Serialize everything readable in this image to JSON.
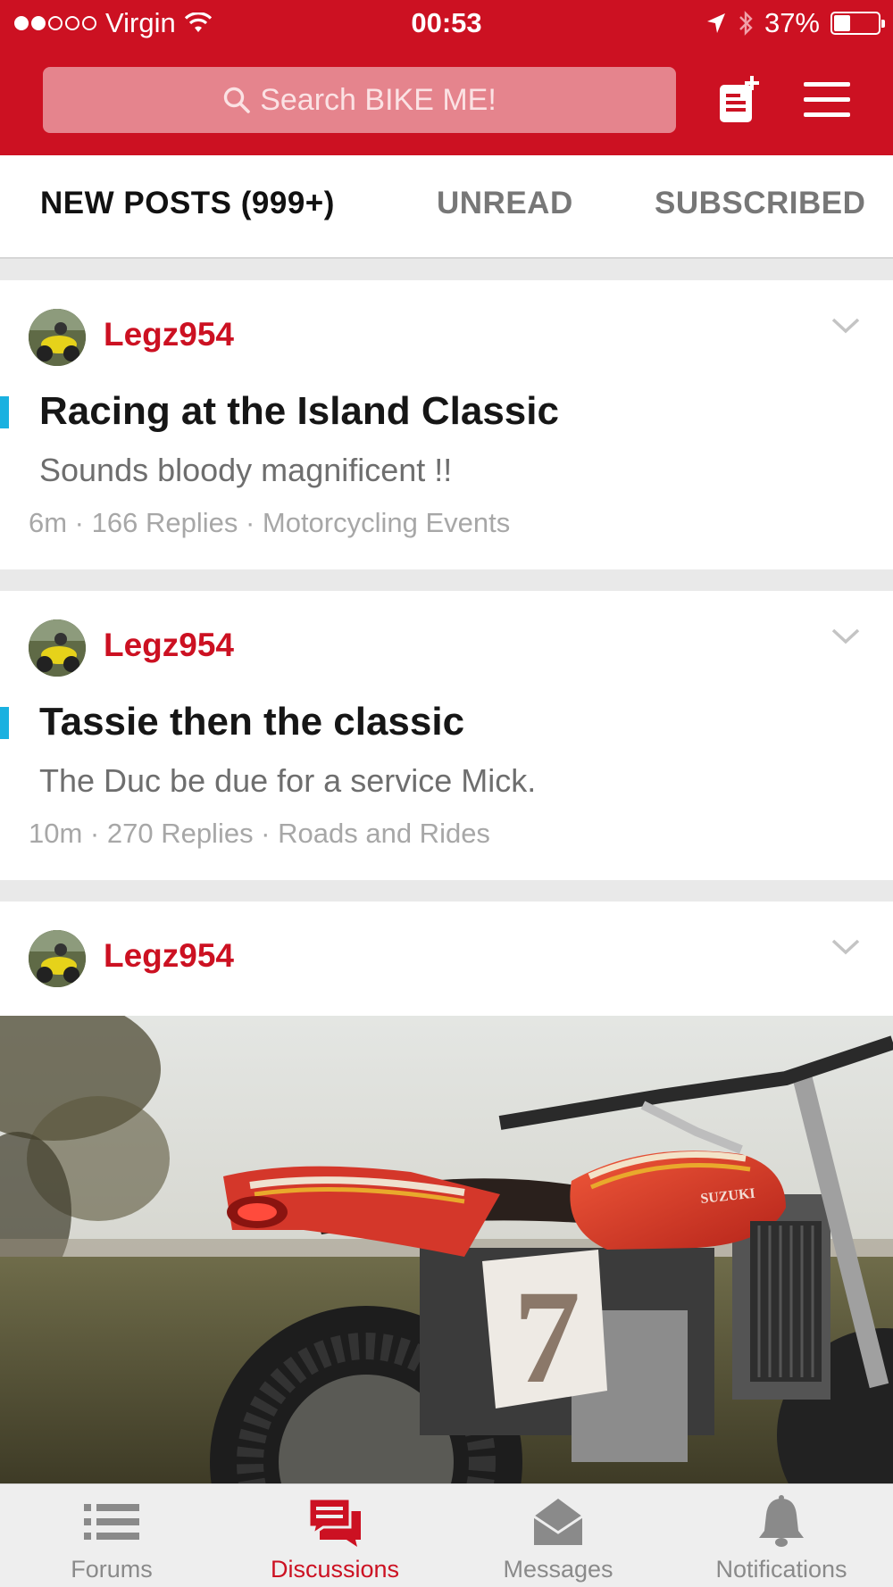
{
  "status_bar": {
    "carrier": "Virgin",
    "time": "00:53",
    "battery": "37%",
    "battery_level": 0.37,
    "signal_bars_filled": 2,
    "signal_bars_total": 5
  },
  "header": {
    "search_placeholder": "Search BIKE ME!",
    "brand_color": "#cc1122"
  },
  "tabs": [
    {
      "label": "NEW POSTS (999+)",
      "active": true
    },
    {
      "label": "UNREAD",
      "active": false
    },
    {
      "label": "SUBSCRIBED",
      "active": false
    }
  ],
  "posts": [
    {
      "author": "Legz954",
      "title": "Racing at the Island Classic",
      "snippet": "Sounds bloody magnificent !!",
      "meta": "6m · 166 Replies · Motorcycling Events",
      "unread": true
    },
    {
      "author": "Legz954",
      "title": "Tassie then the classic",
      "snippet": "The Duc be due for a service Mick.",
      "meta": "10m · 270 Replies · Roads and Rides",
      "unread": true
    },
    {
      "author": "Legz954",
      "image_description_icon": "motorcycle-photo"
    }
  ],
  "photo": {
    "tank_text": "SUZUKI",
    "number_plate": "7"
  },
  "bottom_nav": [
    {
      "label": "Forums",
      "icon": "list-icon",
      "active": false
    },
    {
      "label": "Discussions",
      "icon": "chat-bubbles-icon",
      "active": true
    },
    {
      "label": "Messages",
      "icon": "envelope-open-icon",
      "active": false
    },
    {
      "label": "Notifications",
      "icon": "bell-icon",
      "active": false
    }
  ],
  "colors": {
    "accent": "#cc1122",
    "unread_marker": "#1ab1e0",
    "inactive_nav": "#8a8a8a"
  }
}
